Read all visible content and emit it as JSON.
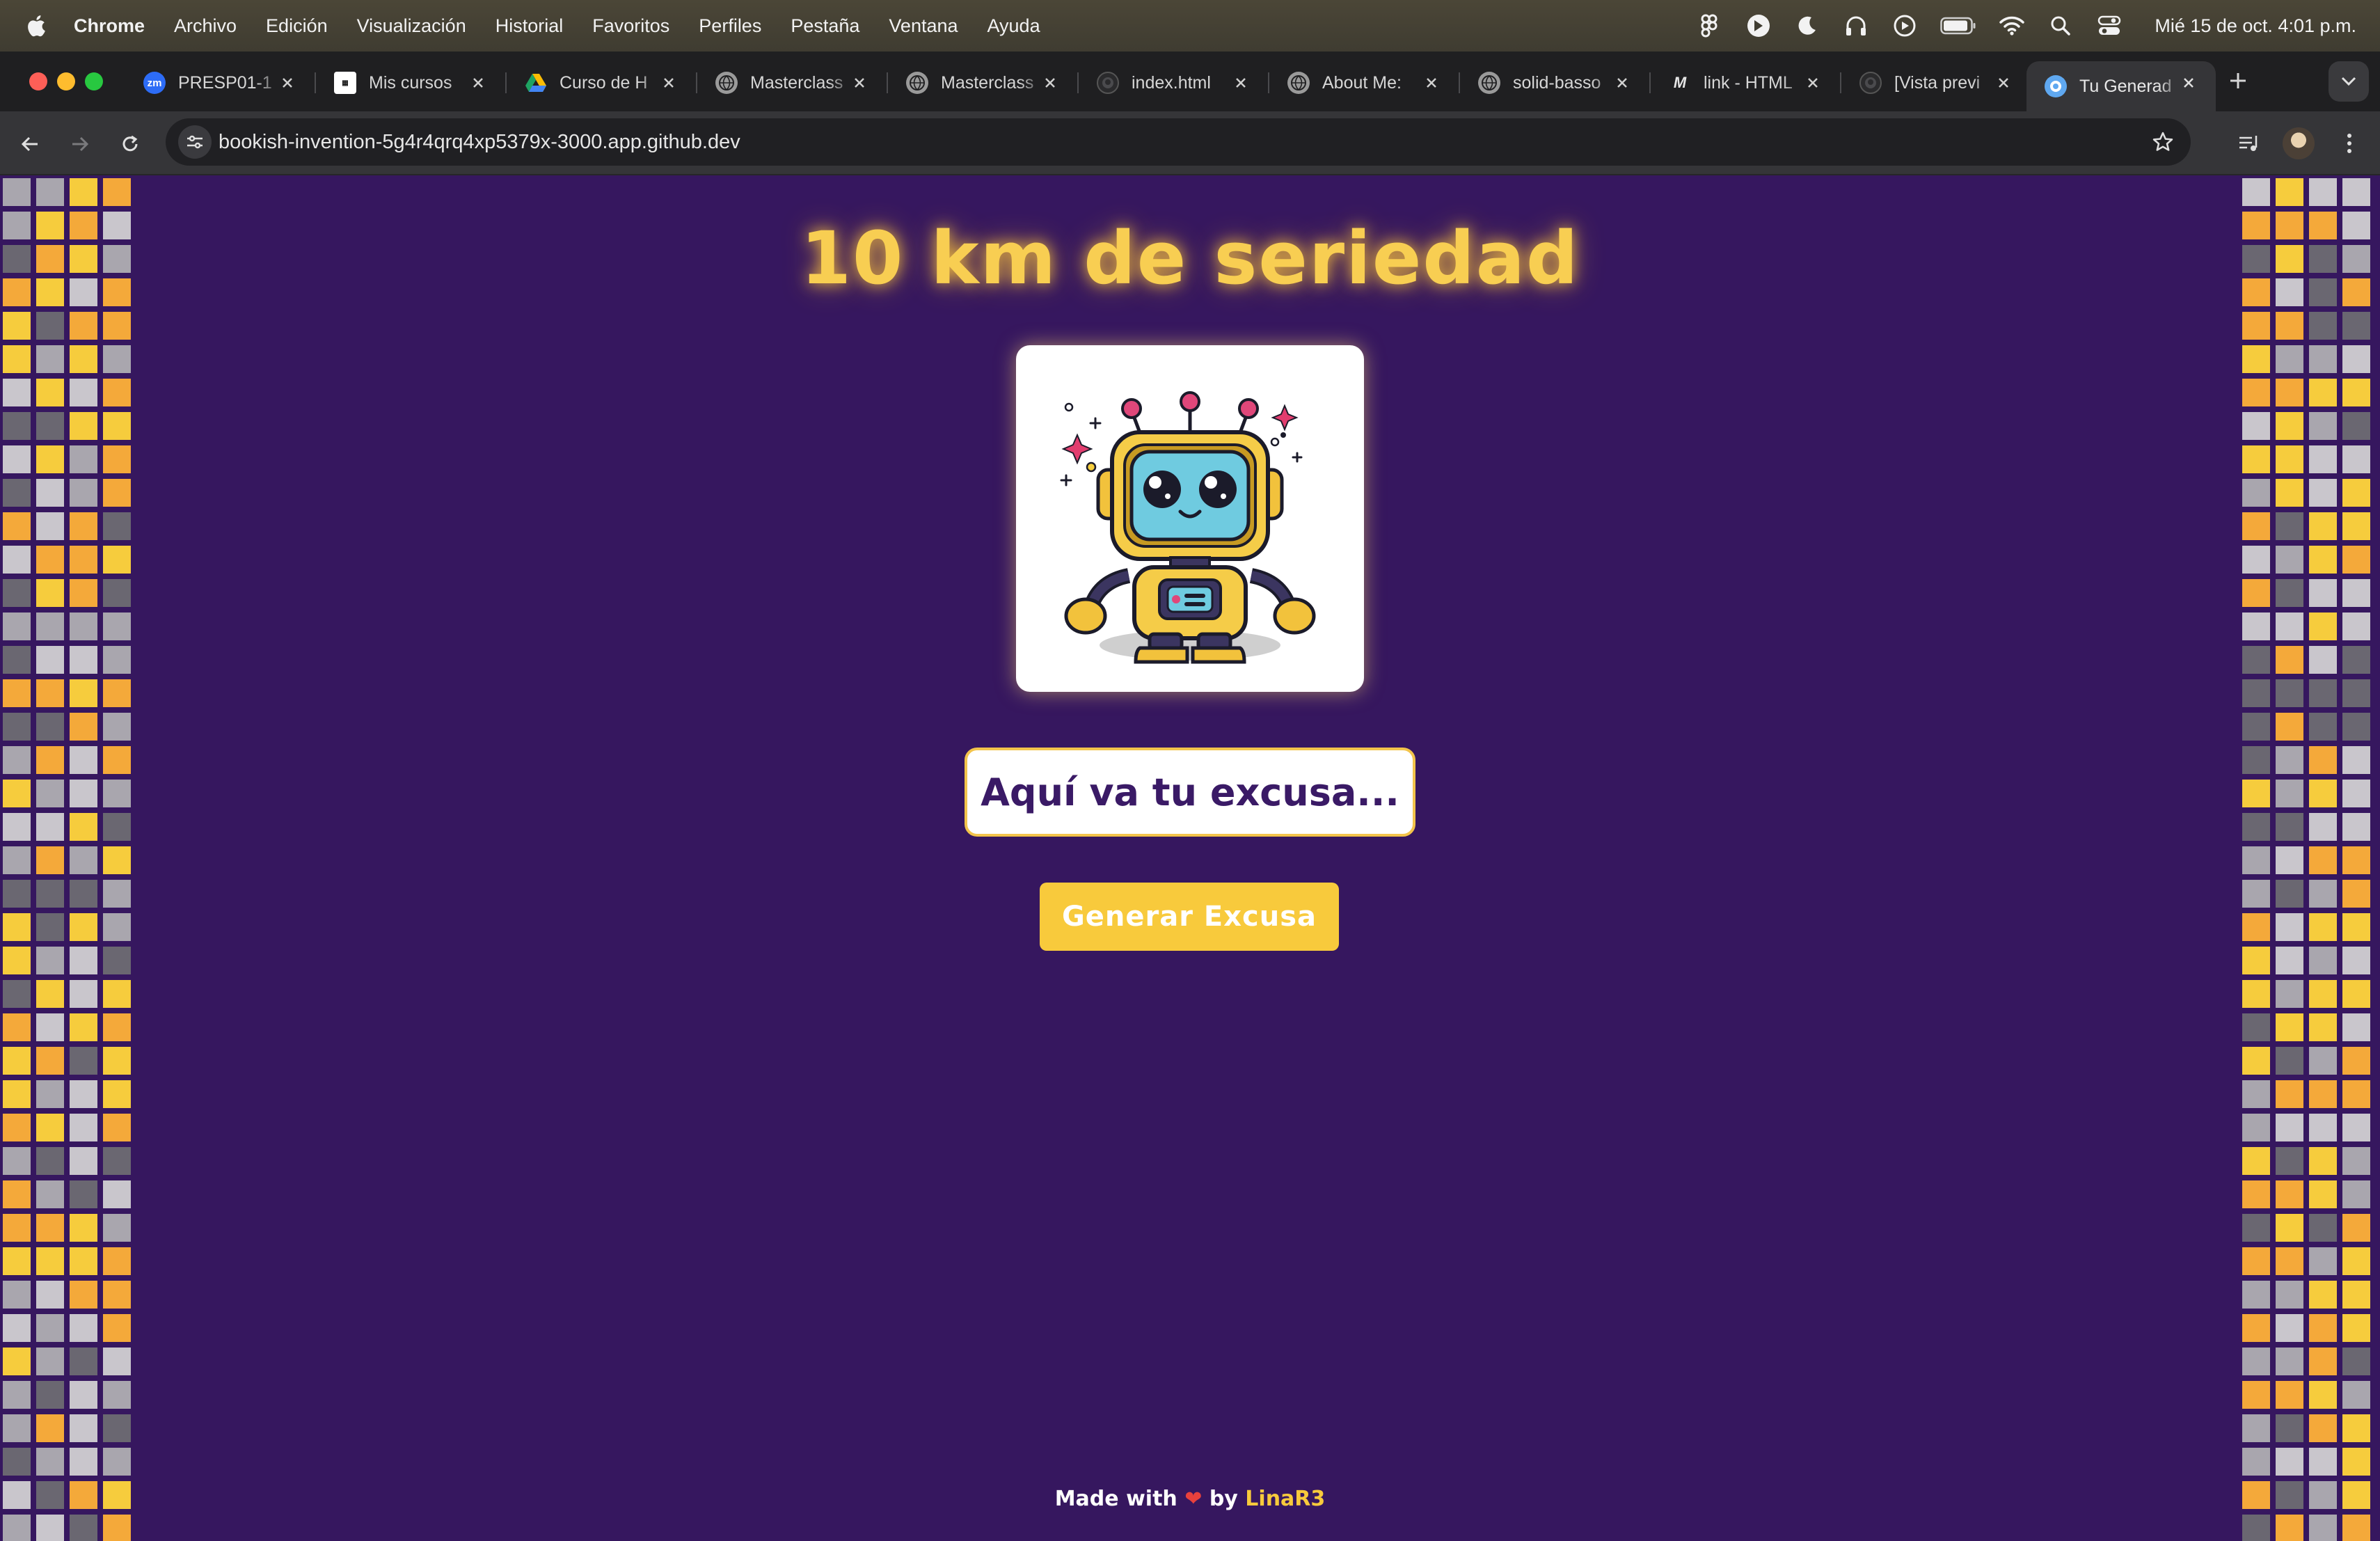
{
  "menubar": {
    "app_name": "Chrome",
    "items": [
      "Archivo",
      "Edición",
      "Visualización",
      "Historial",
      "Favoritos",
      "Perfiles",
      "Pestaña",
      "Ventana",
      "Ayuda"
    ],
    "clock": "Mié 15 de oct.  4:01 p.m."
  },
  "tabs": [
    {
      "title": "PRESP01-1",
      "icon": "zoom-icon"
    },
    {
      "title": "Mis cursos",
      "icon": "platzi-icon"
    },
    {
      "title": "Curso de H",
      "icon": "drive-icon"
    },
    {
      "title": "Masterclass",
      "icon": "globe-icon"
    },
    {
      "title": "Masterclass",
      "icon": "globe-icon"
    },
    {
      "title": "index.html",
      "icon": "github-icon"
    },
    {
      "title": "About Me:",
      "icon": "globe-icon"
    },
    {
      "title": "solid-basso",
      "icon": "globe-icon"
    },
    {
      "title": "link - HTML",
      "icon": "mdn-icon"
    },
    {
      "title": "[Vista previ",
      "icon": "github-icon"
    },
    {
      "title": "Tu Generad",
      "icon": "codespaces-icon",
      "active": true
    }
  ],
  "address_bar": {
    "url": "bookish-invention-5g4r4qrq4xp5379x-3000.app.github.dev"
  },
  "page": {
    "title": "10 km de seriedad",
    "excuse_text": "Aquí va tu excusa...",
    "generate_button": "Generar Excusa",
    "footer_prefix": "Made with",
    "footer_by": "by",
    "footer_author": "LinaR3"
  },
  "colors": {
    "page_background": "#36175f",
    "accent_yellow": "#f8ca3c",
    "title_glow": "#f8ce52"
  }
}
